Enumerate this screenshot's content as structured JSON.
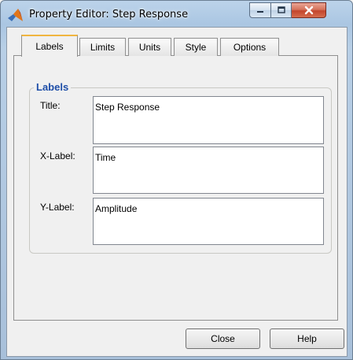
{
  "window": {
    "title": "Property Editor: Step Response"
  },
  "tabs": [
    {
      "label": "Labels"
    },
    {
      "label": "Limits"
    },
    {
      "label": "Units"
    },
    {
      "label": "Style"
    },
    {
      "label": "Options"
    }
  ],
  "labels_group": {
    "title": "Labels",
    "fields": [
      {
        "label": "Title:",
        "value": "Step Response"
      },
      {
        "label": "X-Label:",
        "value": "Time"
      },
      {
        "label": "Y-Label:",
        "value": "Amplitude"
      }
    ]
  },
  "buttons": {
    "close_label": "Close",
    "help_label": "Help"
  },
  "colors": {
    "group_title": "#1e4ea8",
    "active_tab_accent": "#f0b540",
    "close_button_red": "#c3452c"
  },
  "icons": {
    "app": "matlab-logo-icon",
    "minimize": "minimize-icon",
    "maximize": "maximize-icon",
    "close": "close-icon"
  }
}
